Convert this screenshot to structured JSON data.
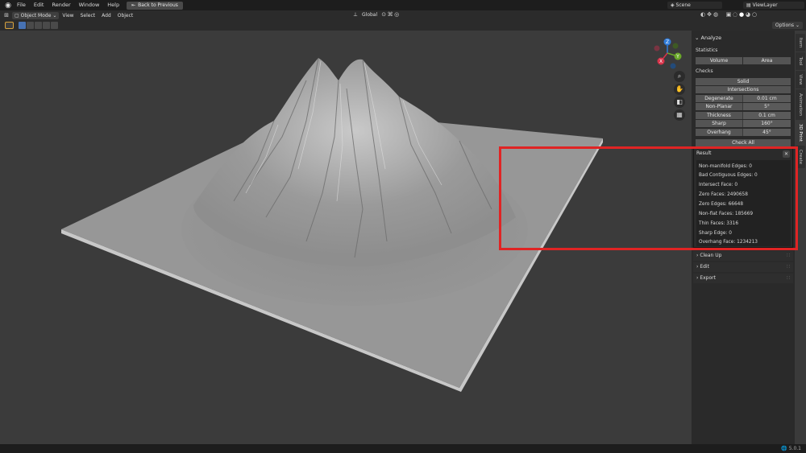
{
  "topbar": {
    "menus": [
      "File",
      "Edit",
      "Render",
      "Window",
      "Help"
    ],
    "back_button": "Back to Previous",
    "scene": "Scene",
    "view_layer": "ViewLayer"
  },
  "header": {
    "mode": "Object Mode",
    "menus": [
      "View",
      "Select",
      "Add",
      "Object"
    ],
    "transform_orientation": "Global"
  },
  "toolrow": {
    "options": "Options"
  },
  "gizmo": {
    "z": "Z",
    "y": "Y",
    "x": "X"
  },
  "sidebar": {
    "panel_title": "Analyze",
    "statistics_label": "Statistics",
    "stat_buttons": [
      "Volume",
      "Area"
    ],
    "checks_label": "Checks",
    "check_buttons": [
      "Solid",
      "Intersections"
    ],
    "fields": [
      {
        "label": "Degenerate",
        "value": "0.01 cm"
      },
      {
        "label": "Non-Planar",
        "value": "5°"
      },
      {
        "label": "Thickness",
        "value": "0.1 cm"
      },
      {
        "label": "Sharp",
        "value": "160°"
      },
      {
        "label": "Overhang",
        "value": "45°"
      }
    ],
    "check_all": "Check All",
    "tabs": [
      "Item",
      "Tool",
      "View",
      "Animation",
      "3D Print",
      "Create"
    ],
    "active_tab": "3D Print",
    "collapsed_panels": [
      "Clean Up",
      "Edit",
      "Export"
    ]
  },
  "result": {
    "title": "Result",
    "lines": [
      "Non-manifold Edges: 0",
      "Bad Contiguous Edges: 0",
      "Intersect Face: 0",
      "Zero Faces: 2490658",
      "Zero Edges: 66648",
      "Non-flat Faces: 185669",
      "Thin Faces: 3316",
      "Sharp Edge: 0",
      "Overhang Face: 1234213"
    ]
  },
  "statusbar": {
    "version": "5.0.1"
  }
}
